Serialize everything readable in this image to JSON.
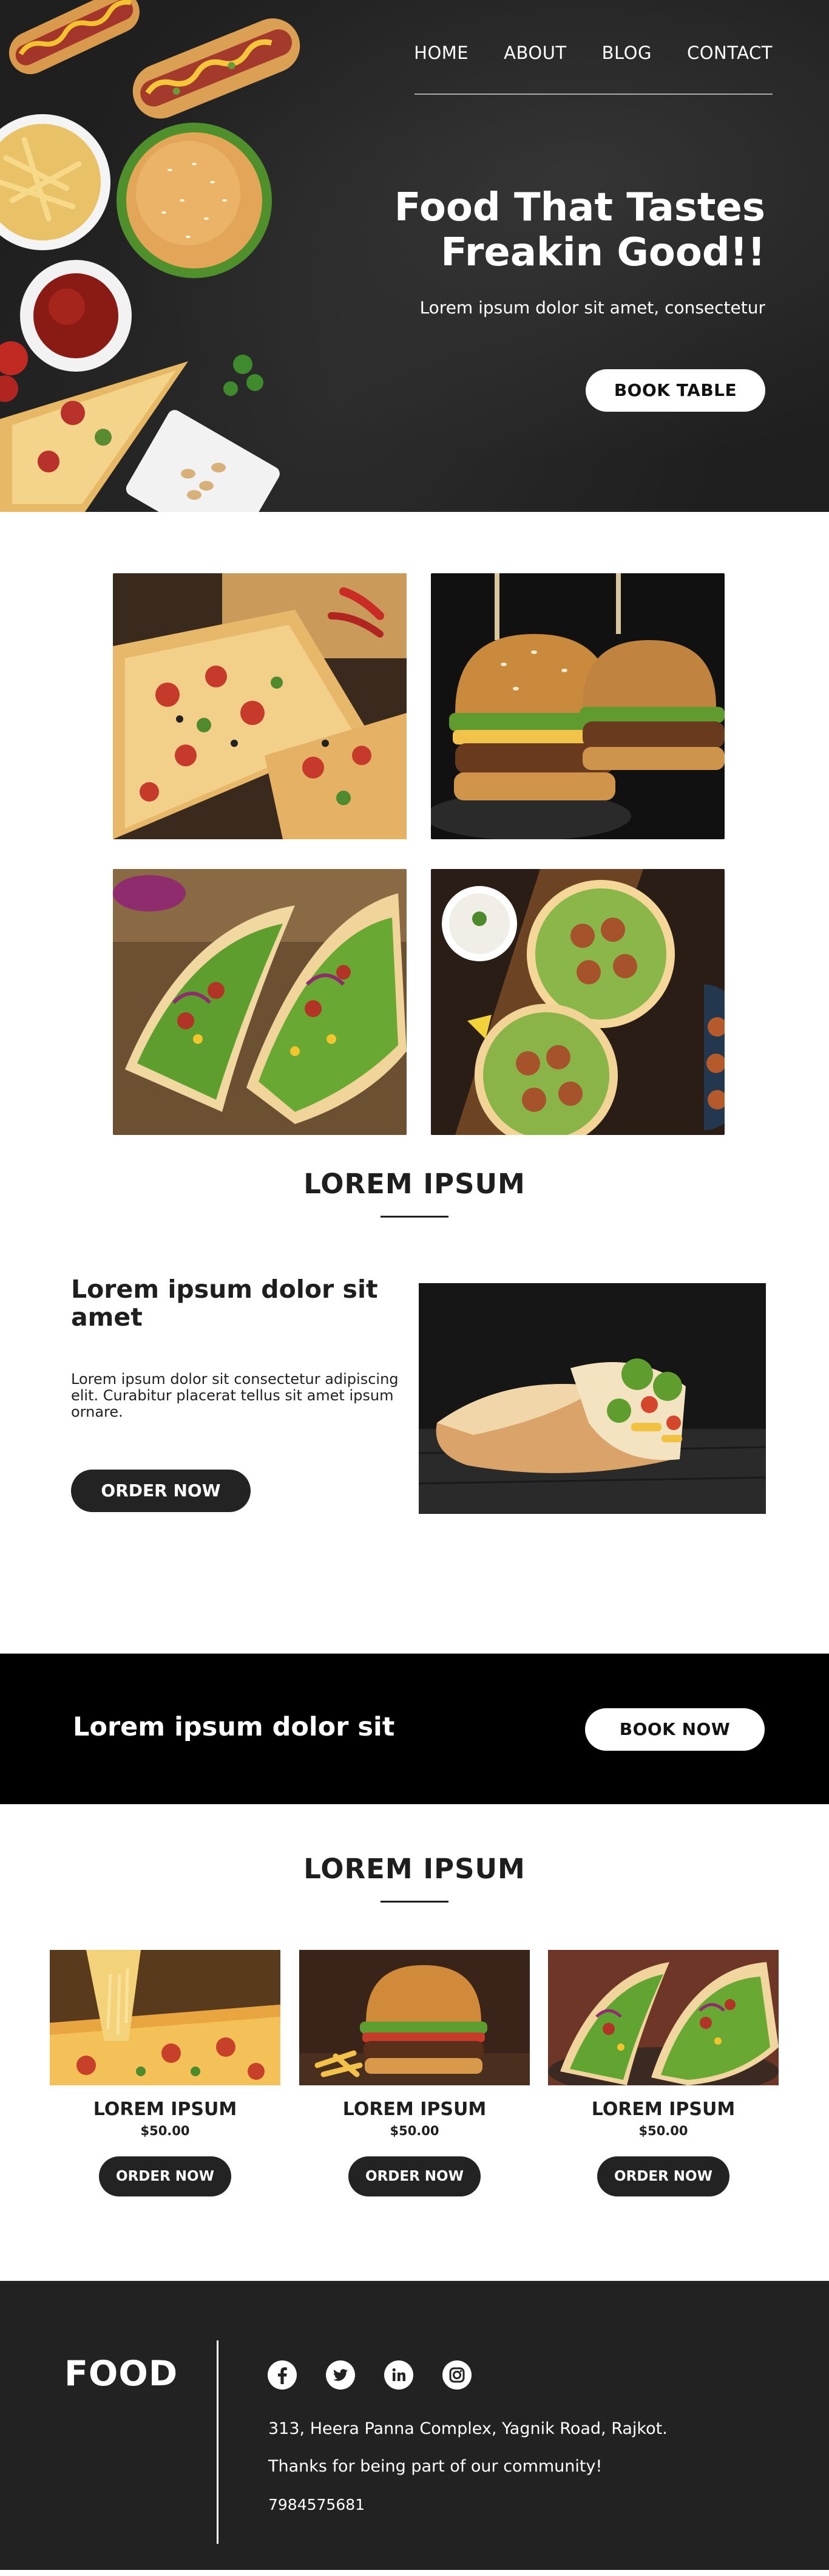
{
  "nav": {
    "items": [
      {
        "label": "HOME"
      },
      {
        "label": "ABOUT"
      },
      {
        "label": "BLOG"
      },
      {
        "label": "CONTACT"
      }
    ]
  },
  "hero": {
    "title_line1": "Food That Tastes",
    "title_line2": "Freakin Good!!",
    "subtitle": "Lorem ipsum dolor sit amet, consectetur",
    "button": "BOOK TABLE"
  },
  "gallery": {
    "images": [
      "pizza-icon",
      "burger-icon",
      "taco-icon",
      "falafel-icon"
    ]
  },
  "about": {
    "section_title": "LOREM IPSUM",
    "heading": "Lorem ipsum dolor sit amet",
    "text": "Lorem ipsum dolor sit consectetur adipiscing elit. Curabitur placerat tellus sit amet ipsum ornare.",
    "button": "ORDER NOW"
  },
  "banner": {
    "text": "Lorem ipsum dolor sit",
    "button": "BOOK NOW"
  },
  "menu": {
    "section_title": "LOREM IPSUM",
    "cards": [
      {
        "title": "LOREM IPSUM",
        "price": "$50.00",
        "button": "ORDER NOW"
      },
      {
        "title": "LOREM IPSUM",
        "price": "$50.00",
        "button": "ORDER NOW"
      },
      {
        "title": "LOREM IPSUM",
        "price": "$50.00",
        "button": "ORDER NOW"
      }
    ]
  },
  "footer": {
    "brand": "FOOD",
    "socials": [
      "facebook-icon",
      "twitter-icon",
      "linkedin-icon",
      "instagram-icon"
    ],
    "address": "313, Heera Panna Complex, Yagnik Road, Rajkot.",
    "tagline": "Thanks for being part of our community!",
    "phone": "7984575681"
  },
  "colors": {
    "dark": "#1f1f1f",
    "footer": "#222222",
    "banner": "#000000",
    "white": "#ffffff"
  }
}
